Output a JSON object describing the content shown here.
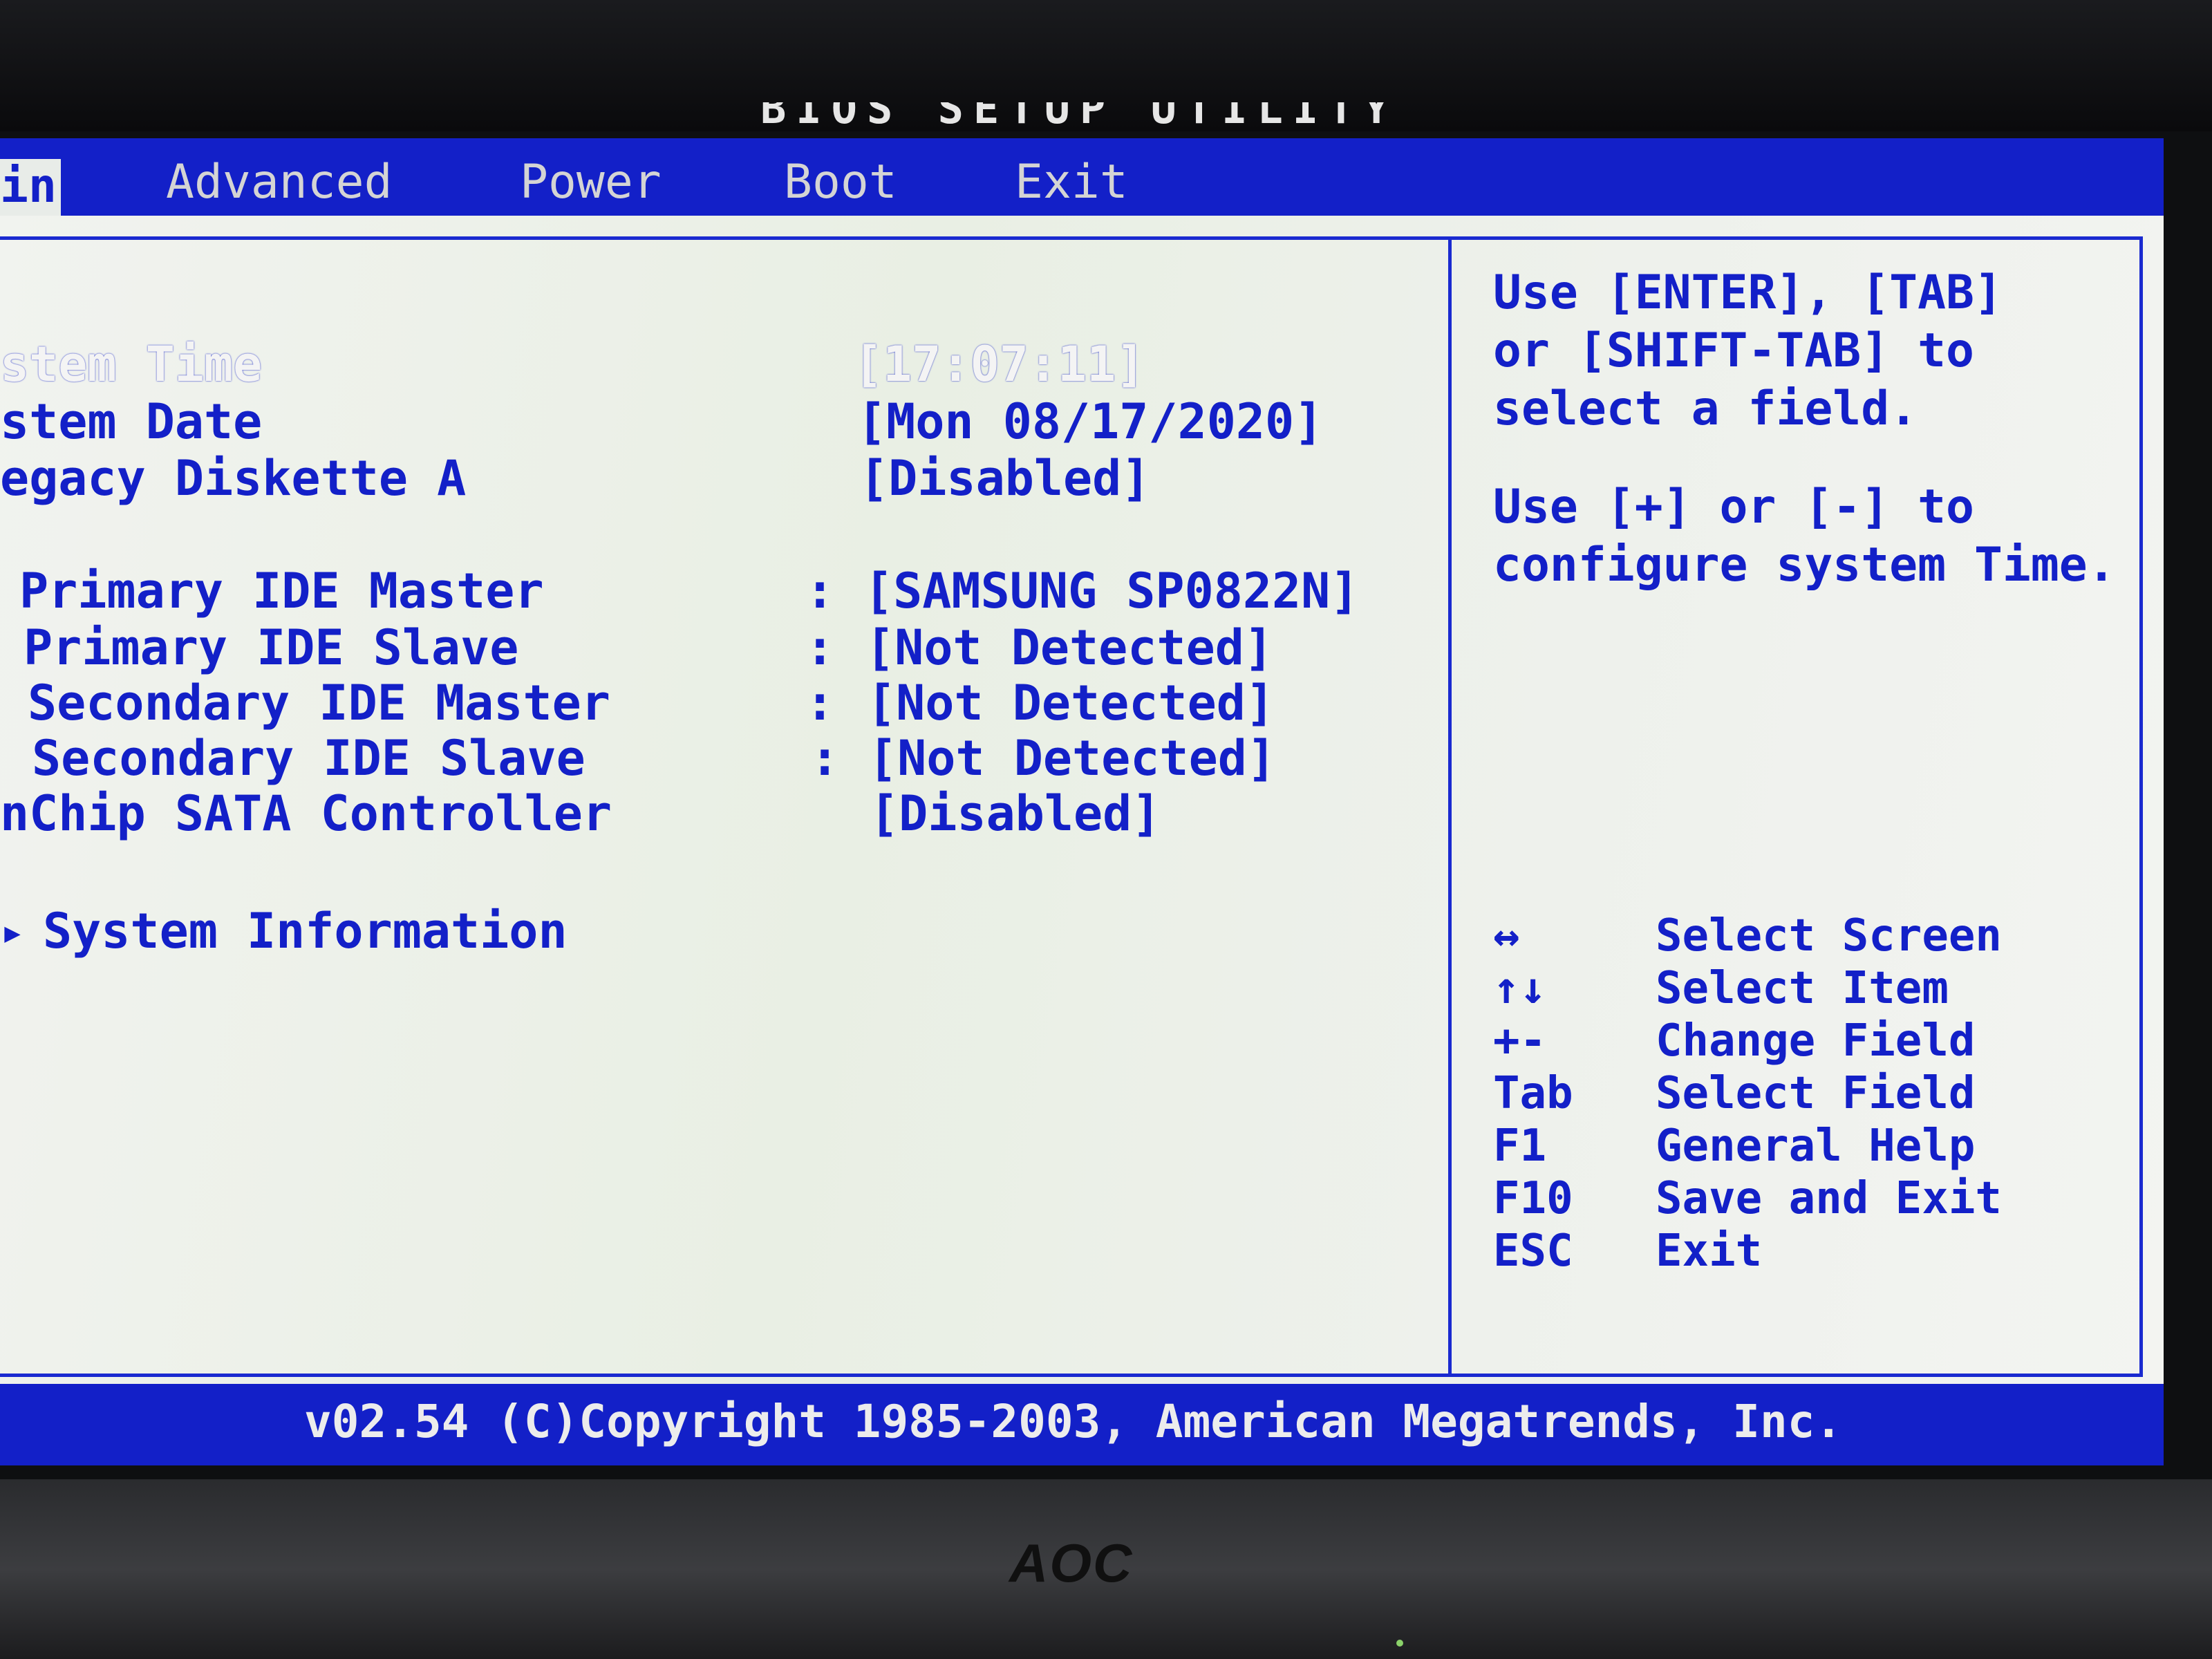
{
  "title": "BIOS SETUP UTILITY",
  "menu": {
    "tabs": [
      {
        "label": "in",
        "active": true
      },
      {
        "label": "Advanced",
        "active": false
      },
      {
        "label": "Power",
        "active": false
      },
      {
        "label": "Boot",
        "active": false
      },
      {
        "label": "Exit",
        "active": false
      }
    ]
  },
  "settings": [
    {
      "label": "stem Time",
      "value": "[17:07:11]",
      "selected": true
    },
    {
      "label": "stem Date",
      "value": "[Mon 08/17/2020]"
    },
    {
      "label": "egacy Diskette A",
      "value": "[Disabled]"
    },
    {
      "label": "Primary IDE Master",
      "colon": ":",
      "value": "[SAMSUNG SP0822N]"
    },
    {
      "label": "Primary IDE Slave",
      "colon": ":",
      "value": "[Not Detected]"
    },
    {
      "label": "Secondary IDE Master",
      "colon": ":",
      "value": "[Not Detected]"
    },
    {
      "label": "Secondary IDE Slave",
      "colon": ":",
      "value": "[Not Detected]"
    },
    {
      "label": "nChip SATA Controller",
      "value": "[Disabled]"
    }
  ],
  "submenu": {
    "arrow": "▸",
    "label": "System Information"
  },
  "help": {
    "lines1": [
      "Use [ENTER], [TAB]",
      "or [SHIFT-TAB] to",
      "select a field."
    ],
    "lines2": [
      "Use [+] or [-] to",
      "configure system Time."
    ]
  },
  "keys": [
    {
      "key": "↔",
      "desc": "Select Screen",
      "icon": "left-right-arrow-icon"
    },
    {
      "key": "↑↓",
      "desc": "Select Item",
      "icon": "up-down-arrow-icon"
    },
    {
      "key": "+-",
      "desc": "Change Field"
    },
    {
      "key": "Tab",
      "desc": "Select Field"
    },
    {
      "key": "F1",
      "desc": "General Help"
    },
    {
      "key": "F10",
      "desc": "Save and Exit"
    },
    {
      "key": "ESC",
      "desc": "Exit"
    }
  ],
  "footer": {
    "copyright": "v02.54 (C)Copyright 1985-2003, American Megatrends, Inc."
  },
  "monitor": {
    "brand": "AOC"
  },
  "colors": {
    "bios_blue": "#1320c8",
    "background": "#eef1ec",
    "highlight": "#f4f4f4"
  }
}
